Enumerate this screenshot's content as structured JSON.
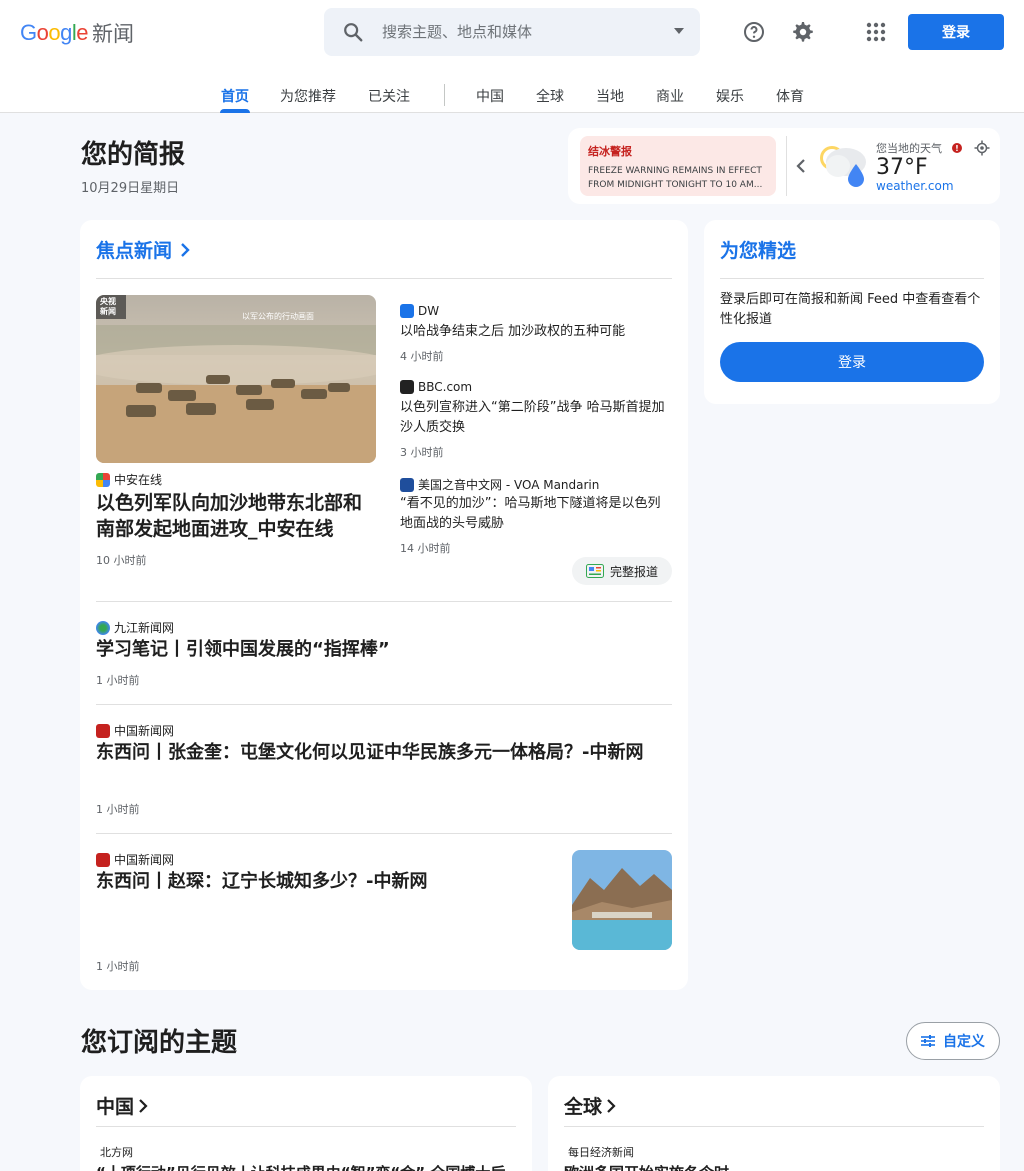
{
  "header": {
    "logo_text": "Google",
    "product": "新闻",
    "search_placeholder": "搜索主题、地点和媒体",
    "signin_label": "登录"
  },
  "tabs": [
    {
      "label": "首页"
    },
    {
      "label": "为您推荐"
    },
    {
      "label": "已关注"
    },
    {
      "label": "中国"
    },
    {
      "label": "全球"
    },
    {
      "label": "当地"
    },
    {
      "label": "商业"
    },
    {
      "label": "娱乐"
    },
    {
      "label": "体育"
    }
  ],
  "briefing": {
    "title": "您的简报",
    "date": "10月29日星期日"
  },
  "weather": {
    "alert_title": "结冰警报",
    "alert_body": "FREEZE WARNING REMAINS IN EFFECT FROM MIDNIGHT TONIGHT TO 10 AM...",
    "local_label": "您当地的天气",
    "temperature": "37°F",
    "source": "weather.com"
  },
  "top_stories": {
    "title": "焦点新闻",
    "image_caption": "以军公布的行动画面",
    "image_badge": "央视新闻",
    "lead": {
      "source": "中安在线",
      "headline": "以色列军队向加沙地带东北部和南部发起地面进攻_中安在线",
      "time": "10 小时前"
    },
    "related": [
      {
        "source": "DW",
        "headline": "以哈战争结束之后 加沙政权的五种可能",
        "time": "4 小时前"
      },
      {
        "source": "BBC.com",
        "headline": "以色列宣称进入“第二阶段”战争 哈马斯首提加沙人质交换",
        "time": "3 小时前"
      },
      {
        "source": "美国之音中文网 - VOA Mandarin",
        "headline": "“看不见的加沙”：哈马斯地下隧道将是以色列地面战的头号威胁",
        "time": "14 小时前"
      }
    ],
    "full_coverage": "完整报道",
    "stories": [
      {
        "source": "九江新闻网",
        "headline": "学习笔记丨引领中国发展的“指挥棒”",
        "time": "1 小时前"
      },
      {
        "source": "中国新闻网",
        "headline": "东西问丨张金奎：屯堡文化何以见证中华民族多元一体格局？-中新网",
        "time": "1 小时前"
      },
      {
        "source": "中国新闻网",
        "headline": "东西问丨赵琛：辽宁长城知多少？-中新网",
        "time": "1 小时前"
      }
    ]
  },
  "picks": {
    "title": "为您精选",
    "text": "登录后即可在简报和新闻 Feed 中查看查看个性化报道",
    "signin_label": "登录"
  },
  "topics": {
    "title": "您订阅的主题",
    "customize": "自定义",
    "cards": [
      {
        "name": "中国",
        "source": "北方网",
        "headline": "“十项行动”见行见效丨让科技成果由“智”变“金” 全国博士后"
      },
      {
        "name": "全球",
        "source": "每日经济新闻",
        "headline": "欧洲多国开始实施冬令时"
      }
    ]
  },
  "colors": {
    "accent": "#1a73e8",
    "background": "#f6f8fc",
    "alert_bg": "#fce8e6"
  }
}
